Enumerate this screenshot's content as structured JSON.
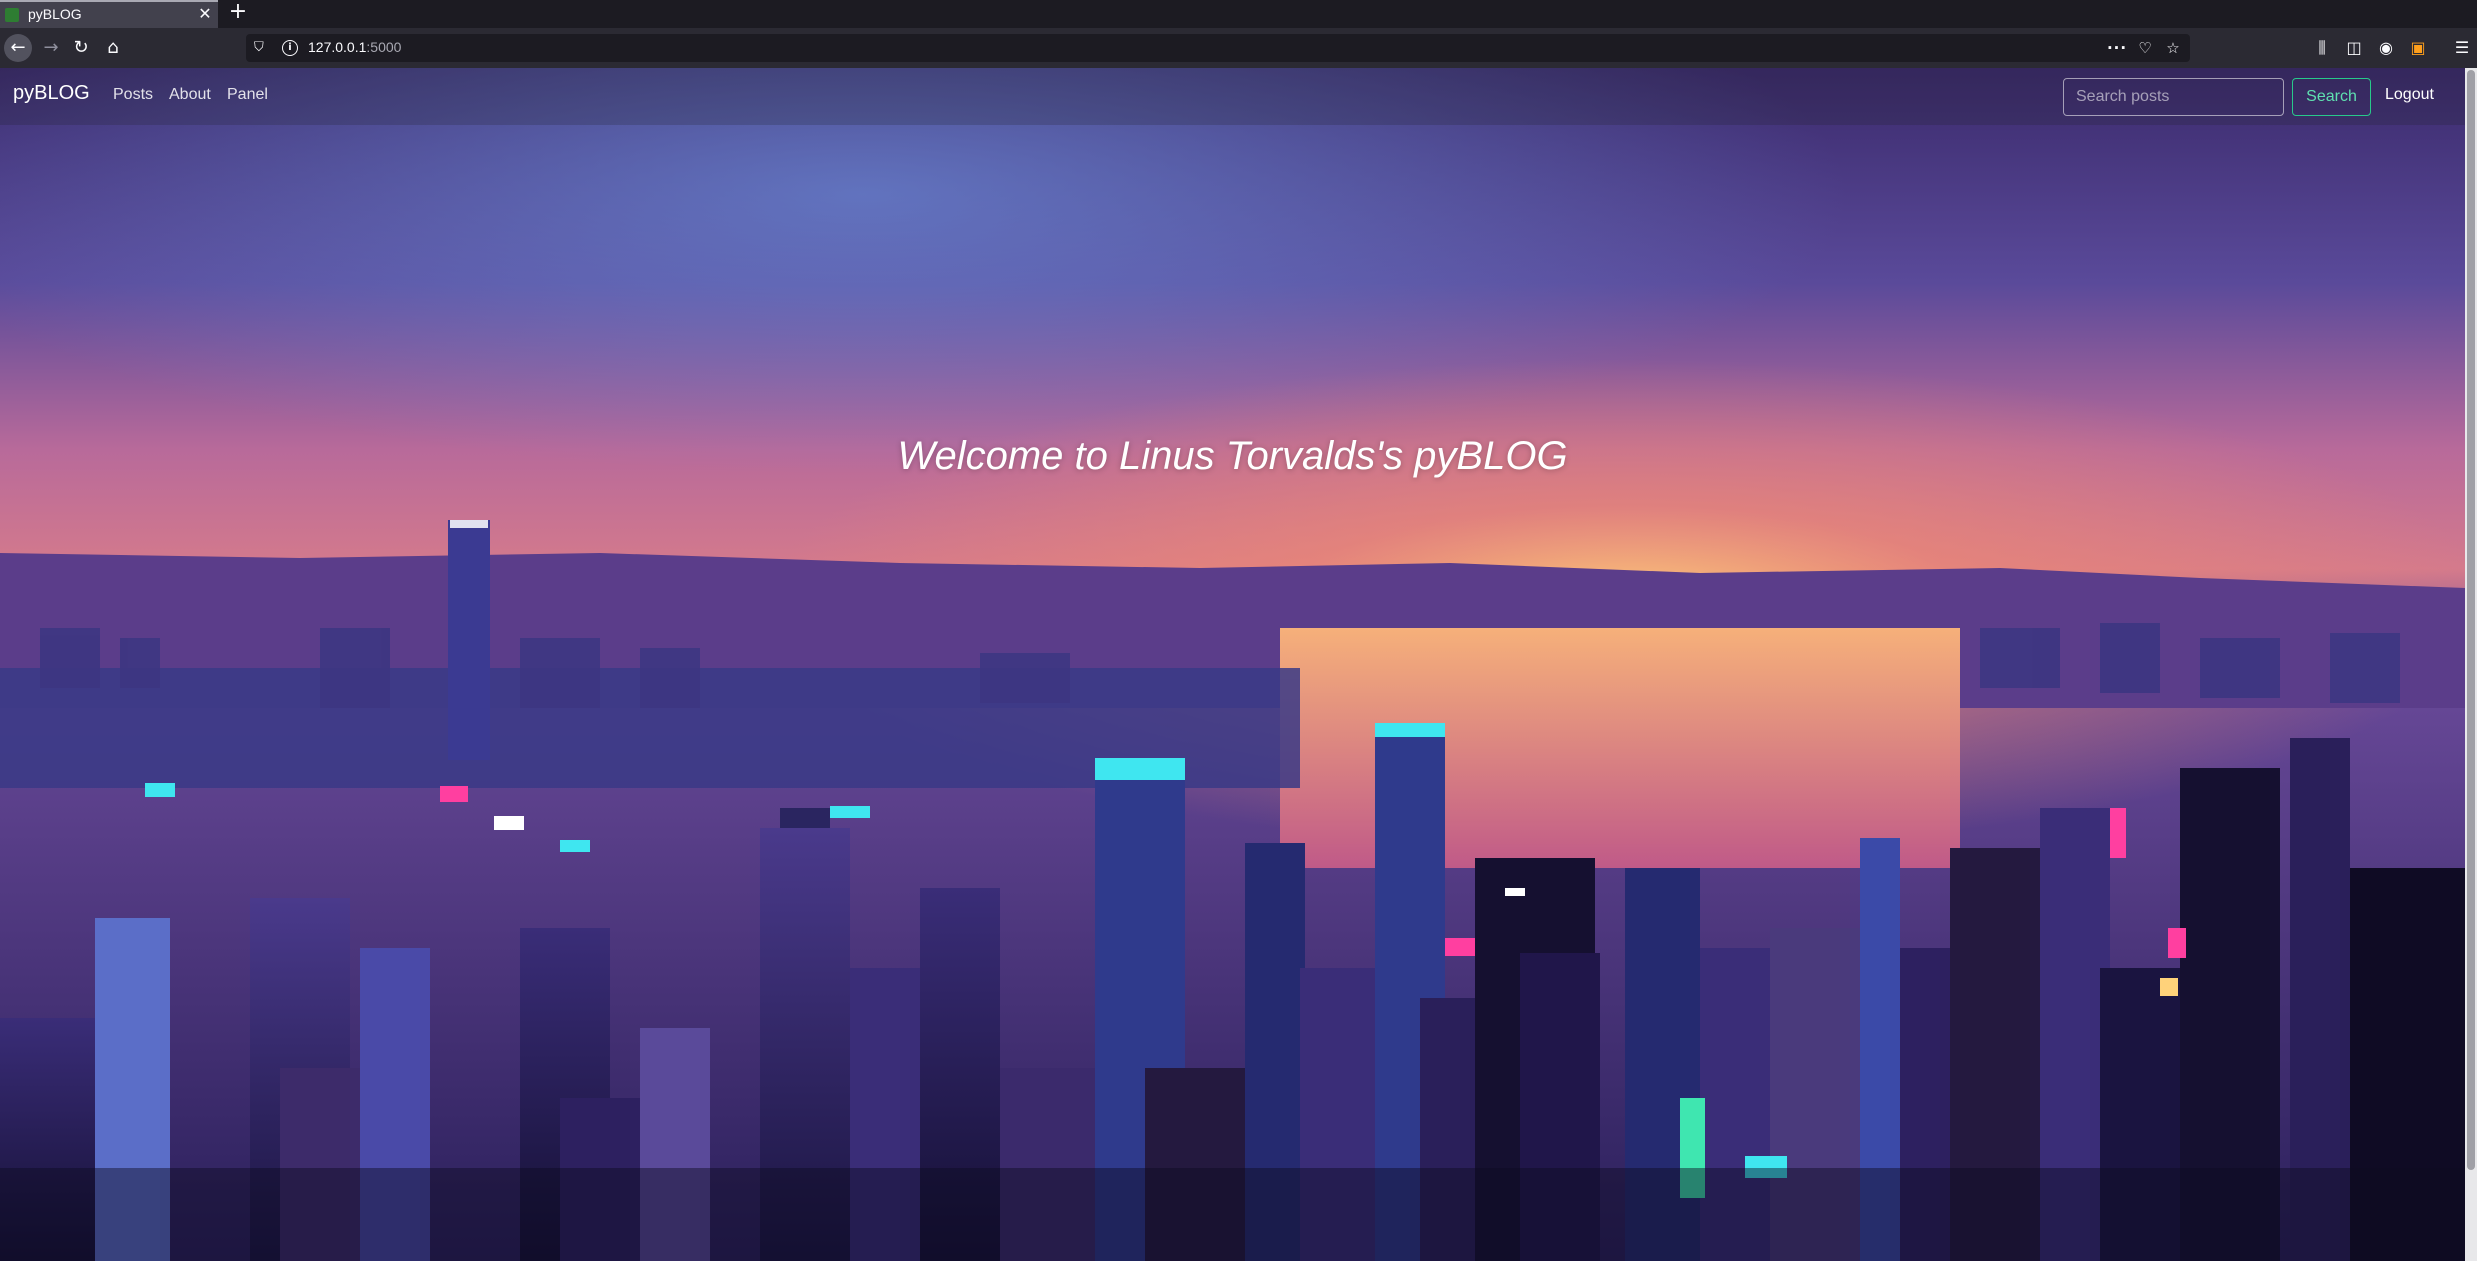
{
  "browser": {
    "tab_title": "pyBLOG",
    "url_host": "127.0.0.1",
    "url_port": ":5000",
    "icons": [
      "favicon",
      "close-icon",
      "new-tab-icon",
      "back-icon",
      "forward-icon",
      "reload-icon",
      "home-icon",
      "shield-icon",
      "info-icon",
      "more-icon",
      "pocket-icon",
      "star-icon",
      "library-icon",
      "sidebar-icon",
      "account-icon",
      "extension-icon",
      "menu-icon"
    ]
  },
  "site": {
    "brand": "pyBLOG",
    "nav": {
      "posts": "Posts",
      "about": "About",
      "panel": "Panel"
    },
    "search": {
      "placeholder": "Search posts",
      "button": "Search"
    },
    "logout": "Logout"
  },
  "hero": {
    "welcome": "Welcome to Linus Torvalds's pyBLOG"
  },
  "colors": {
    "sky_top": "#3a2a6e",
    "sky_glow": "#e07a8f",
    "sunset": "#ffb35c",
    "water": "#f4a070",
    "city_dark": "#1a1440",
    "neon_cyan": "#3fe6f0",
    "neon_pink": "#ff3fa0",
    "search_accent": "#28c98b"
  }
}
